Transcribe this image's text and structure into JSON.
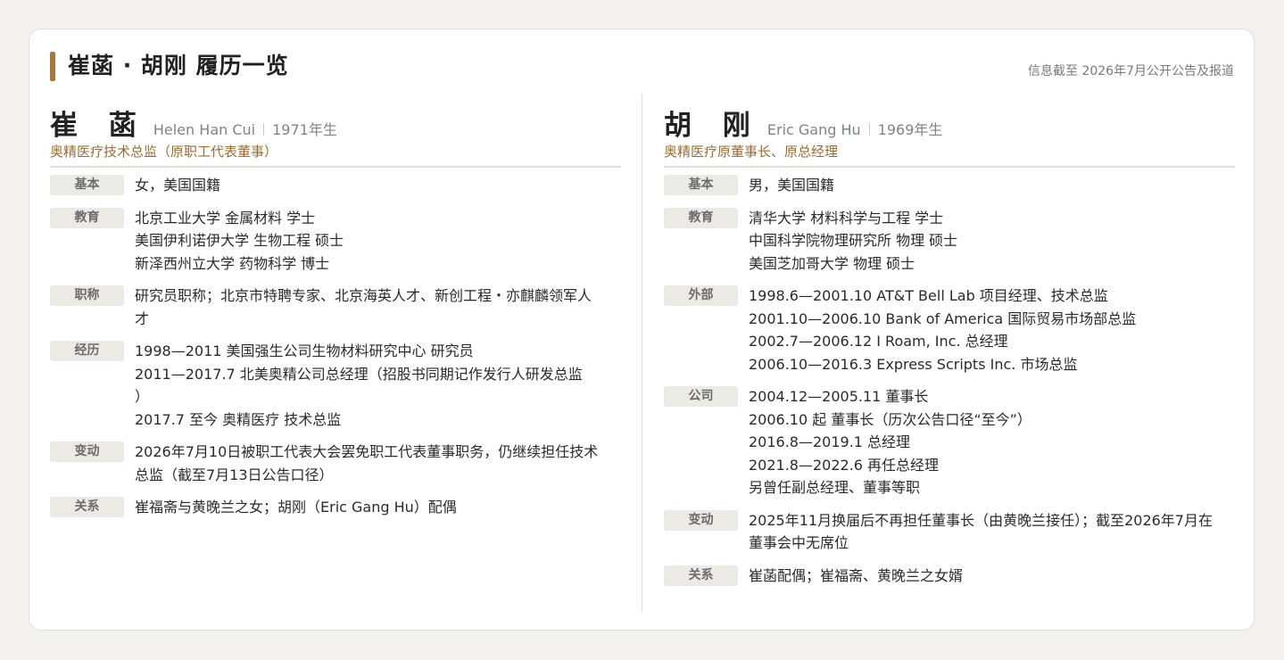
{
  "header": {
    "title": "崔菡 · 胡刚 履历一览",
    "note": "信息截至 2026年7月公开公告及报道"
  },
  "left": {
    "name_cn": "崔 菡",
    "name_en": "Helen Han Cui",
    "born": "1971年生",
    "role": "奥精医疗技术总监（原职工代表董事）",
    "sections": [
      {
        "label": "基本",
        "lines": [
          "女，美国国籍"
        ]
      },
      {
        "label": "教育",
        "lines": [
          "北京工业大学 金属材料 学士",
          "美国伊利诺伊大学 生物工程 硕士",
          "新泽西州立大学 药物科学 博士"
        ]
      },
      {
        "label": "职称",
        "lines": [
          "研究员职称；北京市特聘专家、北京海英人才、新创工程・亦麒麟领军人",
          "才"
        ]
      },
      {
        "label": "经历",
        "lines": [
          "1998—2011 美国强生公司生物材料研究中心 研究员",
          "2011—2017.7 北美奥精公司总经理（招股书同期记作发行人研发总监",
          "）",
          "2017.7 至今 奥精医疗 技术总监"
        ]
      },
      {
        "label": "变动",
        "lines": [
          "2026年7月10日被职工代表大会罢免职工代表董事职务，仍继续担任技术",
          "总监（截至7月13日公告口径）"
        ]
      },
      {
        "label": "关系",
        "lines": [
          "崔福斋与黄晚兰之女；胡刚（Eric Gang Hu）配偶"
        ]
      }
    ]
  },
  "right": {
    "name_cn": "胡 刚",
    "name_en": "Eric Gang Hu",
    "born": "1969年生",
    "role": "奥精医疗原董事长、原总经理",
    "sections": [
      {
        "label": "基本",
        "lines": [
          "男，美国国籍"
        ]
      },
      {
        "label": "教育",
        "lines": [
          "清华大学 材料科学与工程 学士",
          "中国科学院物理研究所 物理 硕士",
          "美国芝加哥大学 物理 硕士"
        ]
      },
      {
        "label": "外部",
        "lines": [
          "1998.6—2001.10 AT&T Bell Lab 项目经理、技术总监",
          "2001.10—2006.10 Bank of America 国际贸易市场部总监",
          "2002.7—2006.12 I Roam, Inc. 总经理",
          "2006.10—2016.3 Express Scripts Inc. 市场总监"
        ]
      },
      {
        "label": "公司",
        "lines": [
          "2004.12—2005.11 董事长",
          "2006.10 起 董事长（历次公告口径“至今”）",
          "2016.8—2019.1 总经理",
          "2021.8—2022.6 再任总经理",
          "另曾任副总经理、董事等职"
        ]
      },
      {
        "label": "变动",
        "lines": [
          "2025年11月换届后不再担任董事长（由黄晚兰接任）；截至2026年7月在",
          "董事会中无席位"
        ]
      },
      {
        "label": "关系",
        "lines": [
          "崔菡配偶；崔福斋、黄晚兰之女婿"
        ]
      }
    ]
  }
}
